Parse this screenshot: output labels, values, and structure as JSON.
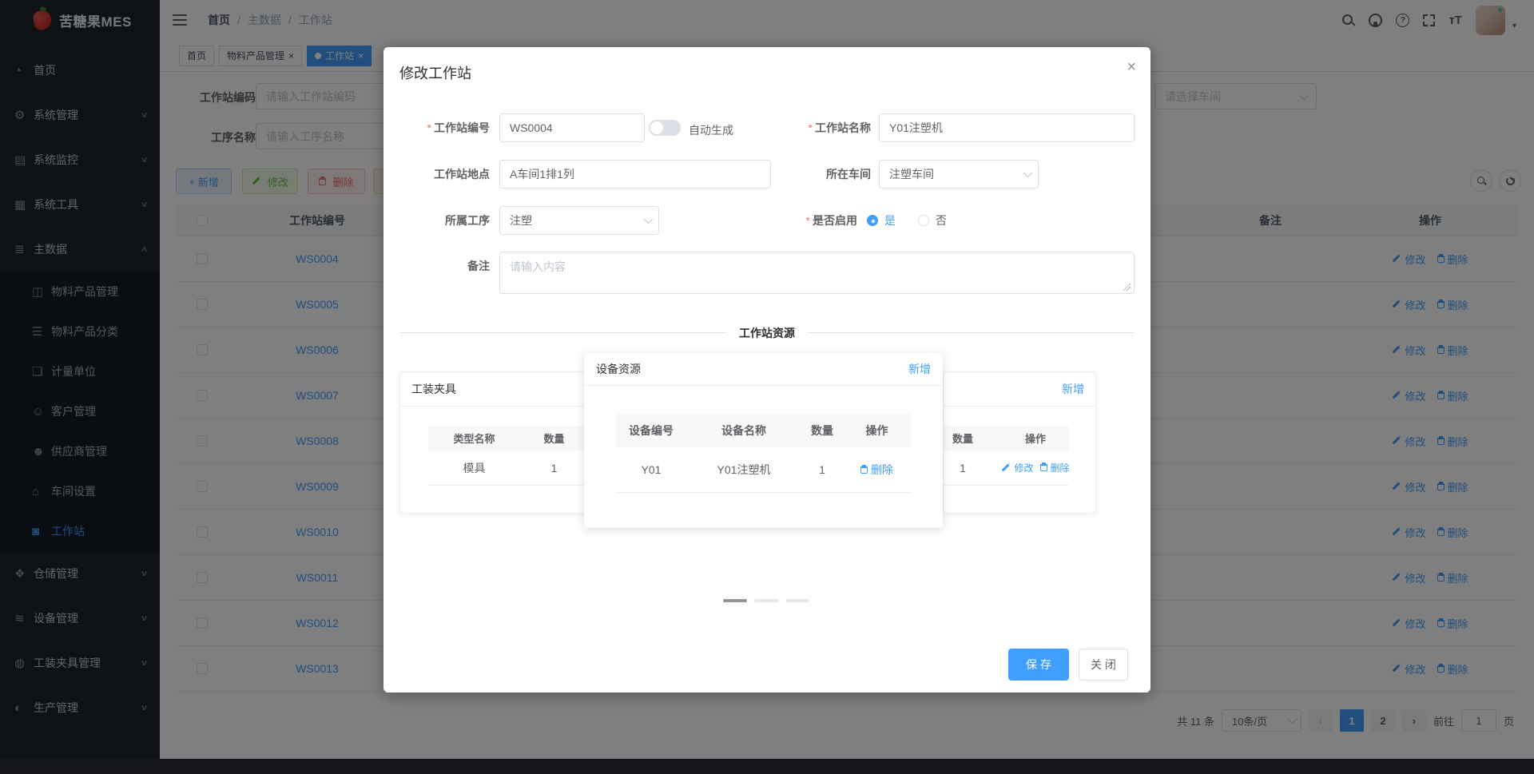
{
  "app": {
    "logo_title": "苦糖果MES"
  },
  "header": {
    "breadcrumb": [
      "首页",
      "主数据",
      "工作站"
    ],
    "sep": "/",
    "help_glyph": "?",
    "font_icon": "тT",
    "avatar_caret": "▾"
  },
  "tabs": {
    "close": "×",
    "items": [
      {
        "label": "首页"
      },
      {
        "label": "物料产品管理"
      },
      {
        "label": "工作站"
      }
    ]
  },
  "sidebar": [
    {
      "glyph": "◔",
      "label": "首页"
    },
    {
      "glyph": "⚙",
      "label": "系统管理",
      "arrow": "∨"
    },
    {
      "glyph": "▤",
      "label": "系统监控",
      "arrow": "∨"
    },
    {
      "glyph": "▦",
      "label": "系统工具",
      "arrow": "∨"
    },
    {
      "glyph": "≣",
      "label": "主数据",
      "arrow": "∧"
    },
    {
      "glyph": "◫",
      "label": "物料产品管理"
    },
    {
      "glyph": "☰",
      "label": "物料产品分类"
    },
    {
      "glyph": "❏",
      "label": "计量单位"
    },
    {
      "glyph": "☺",
      "label": "客户管理"
    },
    {
      "glyph": "☻",
      "label": "供应商管理"
    },
    {
      "glyph": "⌂",
      "label": "车间设置"
    },
    {
      "glyph": "◙",
      "label": "工作站"
    },
    {
      "glyph": "❖",
      "label": "仓储管理",
      "arrow": "∨"
    },
    {
      "glyph": "≋",
      "label": "设备管理",
      "arrow": "∨"
    },
    {
      "glyph": "◍",
      "label": "工装夹具管理",
      "arrow": "∨"
    },
    {
      "glyph": "◐",
      "label": "生产管理",
      "arrow": "∨"
    }
  ],
  "filters": {
    "station_code": {
      "label": "工作站编码",
      "placeholder": "请输入工作站编码"
    },
    "process_name": {
      "label": "工序名称",
      "placeholder": "请输入工序名称"
    },
    "workshop": {
      "placeholder": "请选择车间"
    }
  },
  "toolbar": {
    "add_icon": "+",
    "add": "新增",
    "edit": "修改",
    "delete": "删除"
  },
  "table": {
    "headers": {
      "id": "工作站编号",
      "remark": "备注",
      "action": "操作"
    },
    "action_edit": "修改",
    "action_delete": "删除",
    "rows": [
      {
        "id": "WS0004"
      },
      {
        "id": "WS0005"
      },
      {
        "id": "WS0006"
      },
      {
        "id": "WS0007"
      },
      {
        "id": "WS0008"
      },
      {
        "id": "WS0009"
      },
      {
        "id": "WS0010"
      },
      {
        "id": "WS0011"
      },
      {
        "id": "WS0012"
      },
      {
        "id": "WS0013"
      }
    ]
  },
  "pagination": {
    "total": "共 11 条",
    "page_size": "10条/页",
    "prev": "‹",
    "next": "›",
    "pages": [
      "1",
      "2"
    ],
    "goto_label": "前往",
    "goto_value": "1",
    "goto_suffix": "页"
  },
  "modal": {
    "title": "修改工作站",
    "close": "×",
    "required_mark": "*",
    "form": {
      "code_label": "工作站编号",
      "code_value": "WS0004",
      "auto_label": "自动生成",
      "name_label": "工作站名称",
      "name_value": "Y01注塑机",
      "location_label": "工作站地点",
      "location_value": "A车间1排1列",
      "workshop_label": "所在车间",
      "workshop_value": "注塑车间",
      "process_label": "所属工序",
      "process_value": "注塑",
      "enabled_label": "是否启用",
      "enabled_yes": "是",
      "enabled_no": "否",
      "remark_label": "备注",
      "remark_placeholder": "请输入内容"
    },
    "section_title": "工作站资源",
    "fixture_card": {
      "title": "工装夹具",
      "headers": [
        "类型名称",
        "数量"
      ],
      "row": [
        "模具",
        "1"
      ]
    },
    "device_card": {
      "title": "设备资源",
      "add": "新增",
      "headers": [
        "设备编号",
        "设备名称",
        "数量",
        "操作"
      ],
      "row": {
        "code": "Y01",
        "name": "Y01注塑机",
        "qty": "1"
      },
      "delete": "删除"
    },
    "third_card": {
      "add": "新增",
      "headers": [
        "数量",
        "操作"
      ],
      "row_qty": "1",
      "edit": "修改",
      "delete": "删除"
    },
    "save": "保 存",
    "close_btn": "关 闭"
  }
}
